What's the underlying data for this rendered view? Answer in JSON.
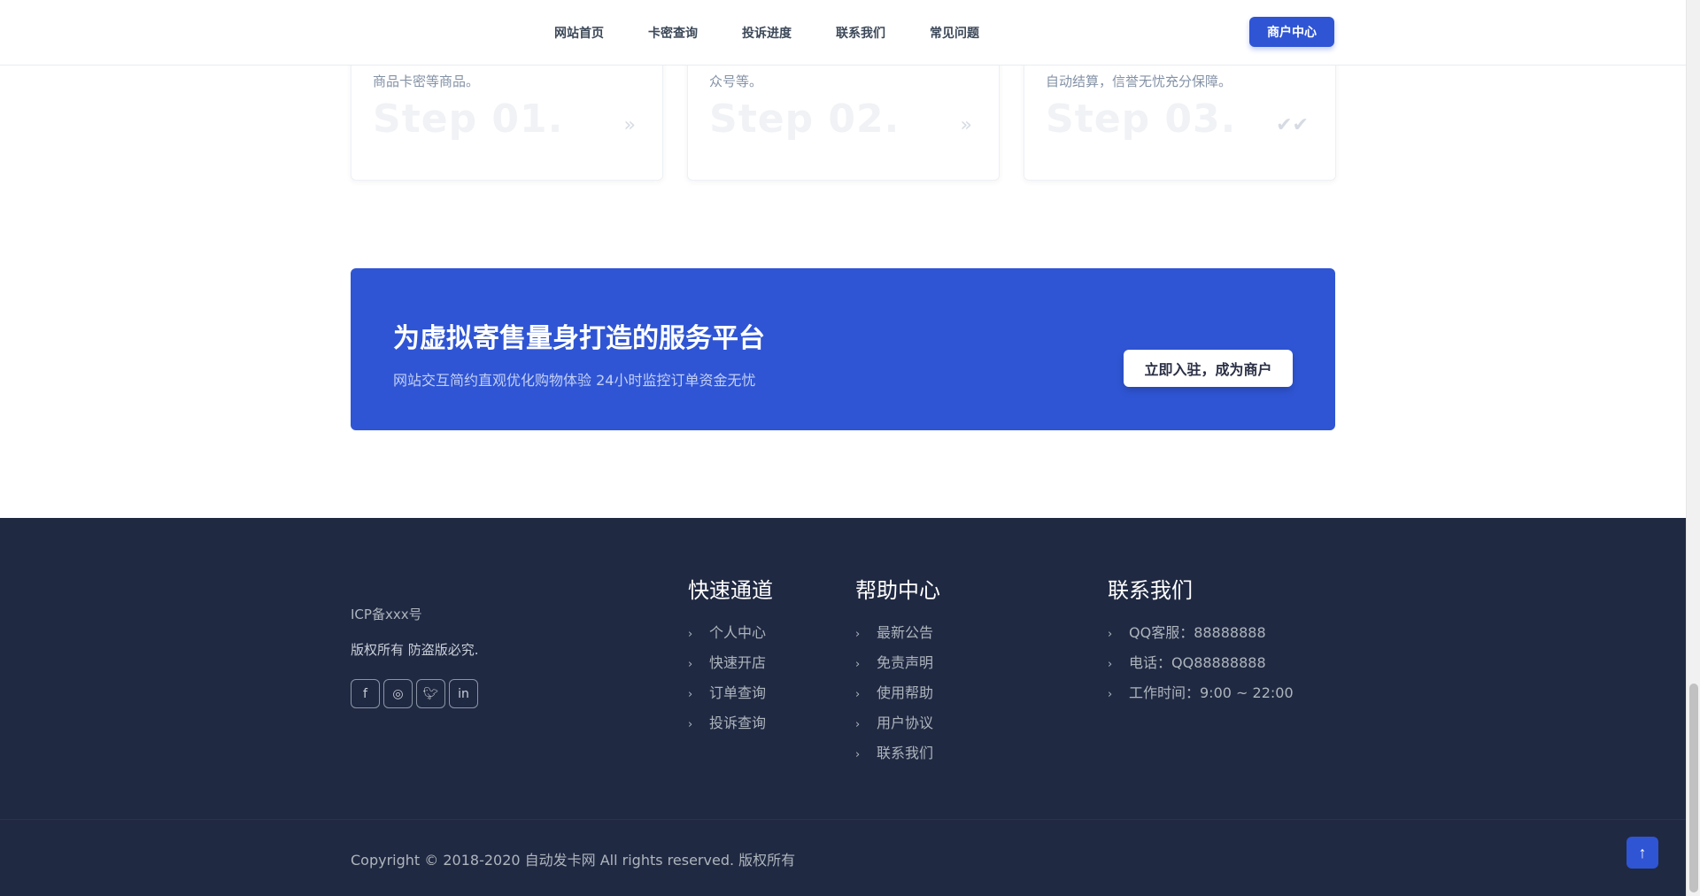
{
  "nav": {
    "items": [
      "网站首页",
      "卡密查询",
      "投诉进度",
      "联系我们",
      "常见问题"
    ],
    "merchant_button": "商户中心"
  },
  "steps": [
    {
      "desc": "商品卡密等商品。",
      "number": "Step 01.",
      "icon": "double-chevron-right-icon"
    },
    {
      "desc": "众号等。",
      "number": "Step 02.",
      "icon": "double-chevron-right-icon"
    },
    {
      "desc": "自动结算，信誉无忧充分保障。",
      "number": "Step 03.",
      "icon": "double-check-icon"
    }
  ],
  "cta": {
    "title": "为虚拟寄售量身打造的服务平台",
    "subtitle": "网站交互简约直观优化购物体验 24小时监控订单资金无忧",
    "button": "立即入驻，成为商户"
  },
  "footer": {
    "icp": "ICP备xxx号",
    "rights": "版权所有 防盗版必究.",
    "socials": [
      "facebook-icon",
      "instagram-icon",
      "twitter-icon",
      "linkedin-icon"
    ],
    "quick": {
      "title": "快速通道",
      "items": [
        "个人中心",
        "快速开店",
        "订单查询",
        "投诉查询"
      ]
    },
    "help": {
      "title": "帮助中心",
      "items": [
        "最新公告",
        "免责声明",
        "使用帮助",
        "用户协议",
        "联系我们"
      ]
    },
    "contact": {
      "title": "联系我们",
      "items": [
        "QQ客服：88888888",
        "电话：QQ88888888",
        "工作时间：9:00 ~ 22:00"
      ]
    },
    "copyright": "Copyright © 2018-2020 自动发卡网 All rights reserved. 版权所有"
  },
  "colors": {
    "primary": "#2f55d4",
    "footer_bg": "#202942"
  }
}
